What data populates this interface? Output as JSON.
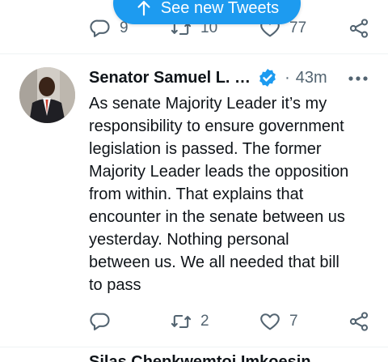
{
  "banner": {
    "label": "See new Tweets",
    "icon": "arrow-up-icon"
  },
  "prev_tweet": {
    "actions": {
      "reply_count": "9",
      "retweet_count": "10",
      "like_count": "77"
    }
  },
  "tweet": {
    "author_name": "Senator Samuel L. …",
    "separator": "·",
    "time": "43m",
    "verified": true,
    "text": "As senate Majority Leader it’s my\nresponsibility to ensure government\nlegislation is passed.  The former\nMajority Leader leads the opposition\nfrom within. That explains that\nencounter in the senate between us\nyesterday. Nothing personal\nbetween us. We all needed that bill\nto pass",
    "actions": {
      "reply_count": "",
      "retweet_count": "2",
      "like_count": "7"
    }
  },
  "next_tweet": {
    "author_name": "Silas Chepkwemtoi Imkoesin"
  },
  "colors": {
    "accent": "#1d9bf0",
    "secondary_text": "#536471",
    "divider": "#eff3f4"
  }
}
